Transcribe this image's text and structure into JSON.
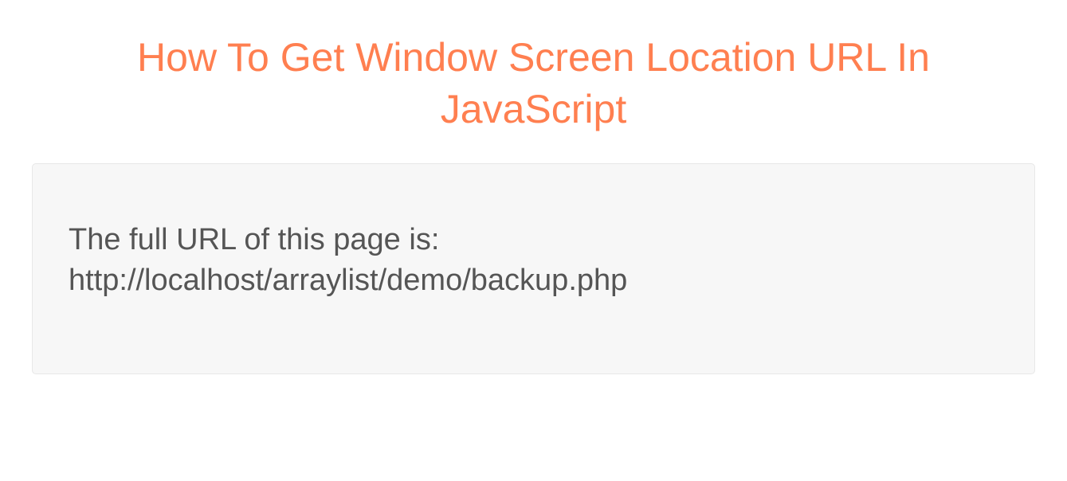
{
  "header": {
    "title": "How To Get Window Screen Location URL In JavaScript"
  },
  "content": {
    "label": "The full URL of this page is:",
    "url": "http://localhost/arraylist/demo/backup.php"
  }
}
